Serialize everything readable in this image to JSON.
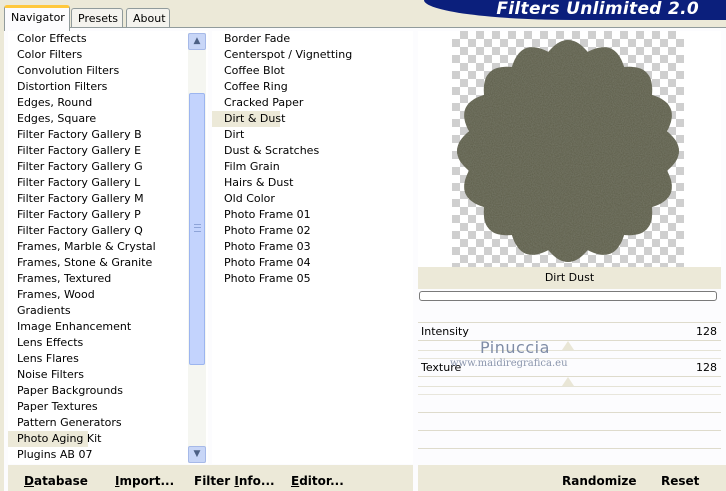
{
  "tabs": [
    {
      "label": "Navigator",
      "active": true
    },
    {
      "label": "Presets",
      "active": false
    },
    {
      "label": "About",
      "active": false
    }
  ],
  "app_title": "Filters Unlimited 2.0",
  "categories": {
    "items": [
      "Color Effects",
      "Color Filters",
      "Convolution Filters",
      "Distortion Filters",
      "Edges, Round",
      "Edges, Square",
      "Filter Factory Gallery B",
      "Filter Factory Gallery E",
      "Filter Factory Gallery G",
      "Filter Factory Gallery L",
      "Filter Factory Gallery M",
      "Filter Factory Gallery P",
      "Filter Factory Gallery Q",
      "Frames, Marble & Crystal",
      "Frames, Stone & Granite",
      "Frames, Textured",
      "Frames, Wood",
      "Gradients",
      "Image Enhancement",
      "Lens Effects",
      "Lens Flares",
      "Noise Filters",
      "Paper Backgrounds",
      "Paper Textures",
      "Pattern Generators",
      "Photo Aging Kit",
      "Plugins AB 07"
    ],
    "selected": "Photo Aging Kit"
  },
  "filters": {
    "items": [
      "Border Fade",
      "Centerspot / Vignetting",
      "Coffee Blot",
      "Coffee Ring",
      "Cracked Paper",
      "Dirt & Dust",
      "Dirt",
      "Dust & Scratches",
      "Film Grain",
      "Hairs & Dust",
      "Old Color",
      "Photo Frame 01",
      "Photo Frame 02",
      "Photo Frame 03",
      "Photo Frame 04",
      "Photo Frame 05"
    ],
    "selected": "Dirt & Dust"
  },
  "preview": {
    "filter_name": "Dirt  Dust",
    "shape_color": "#5b5c47",
    "progress": 0
  },
  "controls": {
    "intensity": {
      "label": "Intensity",
      "value": "128"
    },
    "texture": {
      "label": "Texture",
      "value": "128"
    }
  },
  "watermark": {
    "title": "Pinuccia",
    "url": "www.maidiregrafica.eu"
  },
  "buttons": {
    "database": {
      "first": "D",
      "rest": "atabase"
    },
    "import": {
      "first": "I",
      "rest": "mport..."
    },
    "filter_info": {
      "pre": "Filter ",
      "first": "I",
      "rest": "nfo..."
    },
    "editor": {
      "first": "E",
      "rest": "ditor..."
    },
    "randomize": "Randomize",
    "reset": "Reset"
  },
  "icons": {
    "scroll_up": "chevron-up-icon",
    "scroll_down": "chevron-down-icon"
  }
}
